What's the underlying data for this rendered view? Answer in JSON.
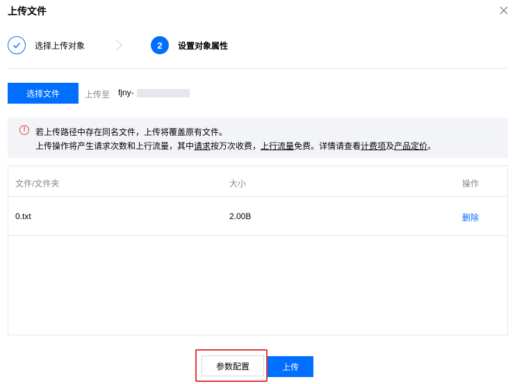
{
  "dialog": {
    "title": "上传文件",
    "close_icon": "close-icon"
  },
  "steps": [
    {
      "label": "选择上传对象",
      "state": "completed",
      "icon": "check-icon"
    },
    {
      "number": "2",
      "label": "设置对象属性",
      "state": "active"
    }
  ],
  "toolbar": {
    "select_file_label": "选择文件",
    "upload_to_label": "上传至",
    "upload_path": "fjny-"
  },
  "notice": {
    "icon": "warning-icon",
    "icon_glyph": "!",
    "line1": "若上传路径中存在同名文件，上传将覆盖原有文件。",
    "line2": {
      "p1": "上传操作将产生请求次数和上行流量，其中",
      "link_request": "请求",
      "p2": "按万次收费，",
      "link_upstream": "上行流量",
      "p3": "免费。详情请查看",
      "link_billing": "计费项",
      "p4": "及",
      "link_pricing": "产品定价",
      "p5": "。"
    }
  },
  "table": {
    "columns": [
      "文件/文件夹",
      "大小",
      "操作"
    ],
    "rows": [
      {
        "name": "0.txt",
        "size": "2.00B",
        "action": "删除"
      }
    ]
  },
  "footer": {
    "params_label": "参数配置",
    "upload_label": "上传"
  },
  "colors": {
    "primary": "#006eff",
    "highlight": "#e03b3b",
    "warning": "#e54545"
  }
}
